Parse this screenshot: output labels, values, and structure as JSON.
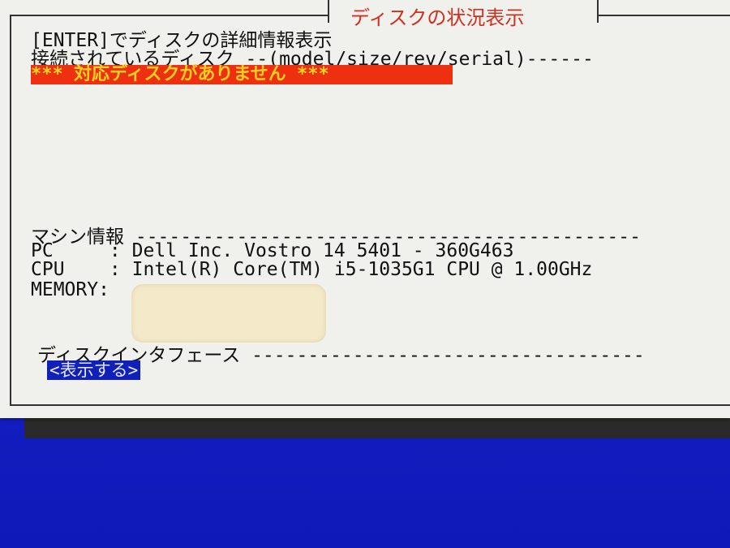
{
  "window": {
    "title": "ディスクの状況表示"
  },
  "hint": {
    "enter_text": "[ENTER]でディスクの詳細情報表示"
  },
  "disks": {
    "header": "接続されているディスク --(model/size/rev/serial)------",
    "warning": "*** 対応ディスクがありません ***"
  },
  "machine": {
    "header": "マシン情報 ---------------------------------------------",
    "pc_label": "PC     :",
    "pc_value": " Dell Inc. Vostro 14 5401 - 360G463",
    "cpu_label": "CPU    :",
    "cpu_value": " Intel(R) Core(TM) i5-1035G1 CPU @ 1.00GHz",
    "memory_label": "MEMORY:"
  },
  "interface": {
    "header": "ディスクインタフェース -----------------------------------",
    "show_button": "<表示する>"
  },
  "colors": {
    "background_blue": "#1a23c9",
    "panel": "#f0f0ec",
    "title_red": "#d03020",
    "warning_bg": "#ee3010",
    "warning_fg": "#f6d020",
    "button_bg": "#1020b8"
  }
}
